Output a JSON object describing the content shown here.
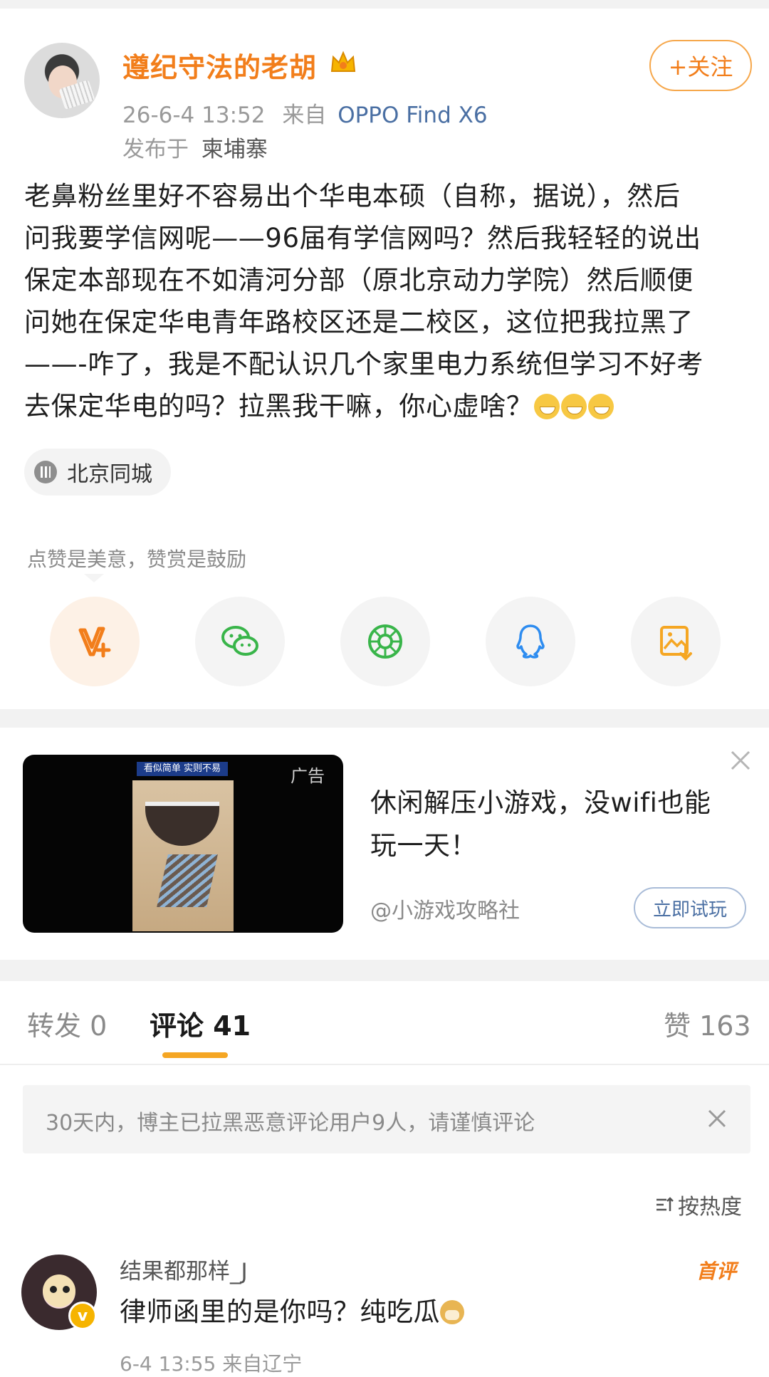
{
  "post": {
    "username": "遵纪守法的老胡",
    "follow_label": "+关注",
    "time": "26-6-4 13:52",
    "from_prefix": "来自",
    "device": "OPPO Find X6",
    "published_prefix": "发布于",
    "published_place": "柬埔寨",
    "body_lines": [
      "老鼻粉丝里好不容易出个华电本硕（自称，据说），然后",
      "问我要学信网呢——96届有学信网吗？然后我轻轻的说出",
      "保定本部现在不如清河分部（原北京动力学院）然后顺便",
      "问她在保定华电青年路校区还是二校区，这位把我拉黑了",
      "——-咋了，我是不配认识几个家里电力系统但学习不好考",
      "去保定华电的吗？拉黑我干嘛，你心虚啥？"
    ],
    "location_chip": "北京同城",
    "like_hint": "点赞是美意，赞赏是鼓励",
    "share_icons": [
      "v-plus-icon",
      "wechat-icon",
      "moments-icon",
      "qq-icon",
      "save-image-icon"
    ]
  },
  "ad": {
    "tag": "广告",
    "image_banner": "看似简单 实则不易",
    "title_lines": [
      "休闲解压小游戏，没wifi也能",
      "玩一天！"
    ],
    "author": "@小游戏攻略社",
    "button": "立即试玩"
  },
  "tabs": {
    "repost": "转发 0",
    "comments": "评论 41",
    "likes": "赞 163"
  },
  "notice": {
    "text": "30天内，博主已拉黑恶意评论用户9人，请谨慎评论"
  },
  "sort_label": "按热度",
  "comment": {
    "name": "结果都那样_J",
    "badge": "首评",
    "text": "律师函里的是你吗？纯吃瓜",
    "meta": "6-4 13:55  来自辽宁"
  },
  "colors": {
    "accent": "#f27e1b",
    "link": "#4a6fa3",
    "background_band": "#f2f2f2"
  }
}
